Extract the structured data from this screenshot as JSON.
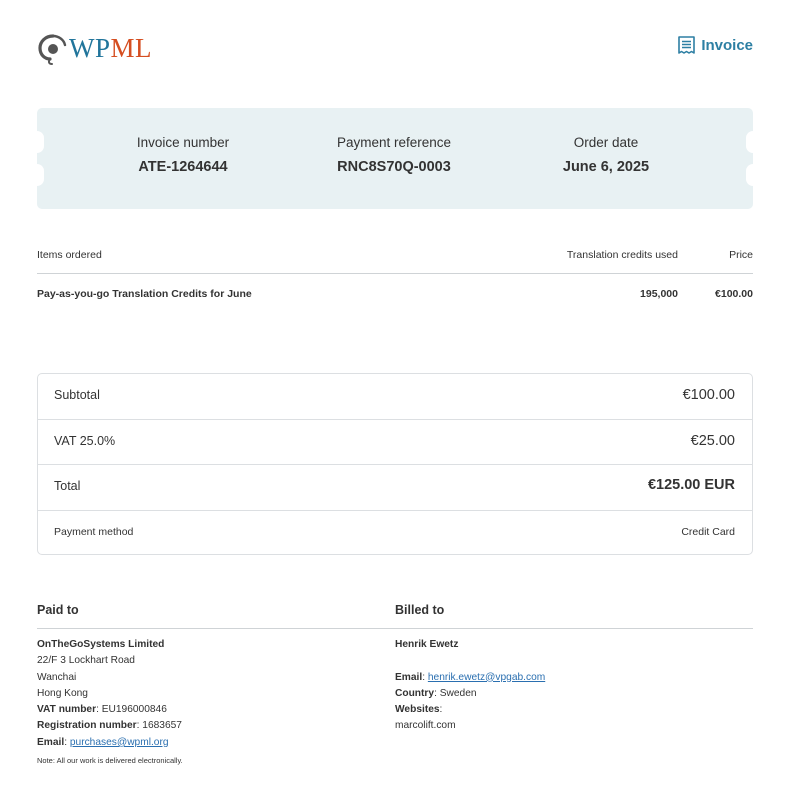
{
  "header": {
    "logo_text": "WPML",
    "doc_type": "Invoice",
    "brand_colors": {
      "blue": "#21759b",
      "orange": "#d54e21",
      "accent": "#2d7fa3"
    }
  },
  "ticket": {
    "invoice_number_label": "Invoice number",
    "invoice_number": "ATE-1264644",
    "payment_reference_label": "Payment reference",
    "payment_reference": "RNC8S70Q-0003",
    "order_date_label": "Order date",
    "order_date": "June 6, 2025"
  },
  "items": {
    "headers": [
      "Items ordered",
      "Translation credits used",
      "Price"
    ],
    "rows": [
      {
        "name": "Pay-as-you-go Translation Credits for June",
        "credits": "195,000",
        "price": "€100.00"
      }
    ]
  },
  "totals": {
    "subtotal_label": "Subtotal",
    "subtotal": "€100.00",
    "vat_label": "VAT 25.0%",
    "vat": "€25.00",
    "total_label": "Total",
    "total": "€125.00 EUR",
    "payment_method_label": "Payment method",
    "payment_method": "Credit Card"
  },
  "paid_to": {
    "heading": "Paid to",
    "company": "OnTheGoSystems Limited",
    "address1": "22/F 3 Lockhart Road",
    "address2": "Wanchai",
    "address3": "Hong Kong",
    "vat_label": "VAT number",
    "vat_number": "EU196000846",
    "reg_label": "Registration number",
    "reg_number": "1683657",
    "email_label": "Email",
    "email": "purchases@wpml.org"
  },
  "billed_to": {
    "heading": "Billed to",
    "name": "Henrik Ewetz",
    "email_label": "Email",
    "email": "henrik.ewetz@vpgab.com",
    "country_label": "Country",
    "country": "Sweden",
    "websites_label": "Websites",
    "website": "marcolift.com"
  },
  "note": "Note: All our work is delivered electronically."
}
